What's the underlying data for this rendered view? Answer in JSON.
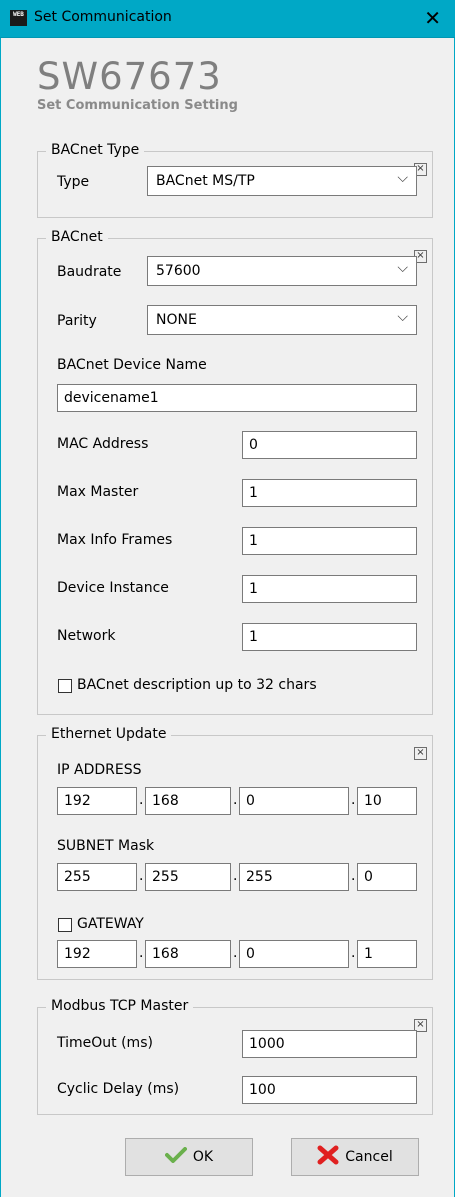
{
  "window": {
    "title": "Set Communication",
    "close_icon": "close-icon",
    "app_icon_text": "WEB"
  },
  "header": {
    "brand": "SW67673",
    "subtitle": "Set Communication Setting"
  },
  "bacnet_type": {
    "legend": "BACnet Type",
    "type_label": "Type",
    "type_value": "BACnet MS/TP"
  },
  "bacnet": {
    "legend": "BACnet",
    "baudrate_label": "Baudrate",
    "baudrate_value": "57600",
    "parity_label": "Parity",
    "parity_value": "NONE",
    "device_name_label": "BACnet Device Name",
    "device_name_value": "devicename1",
    "mac_label": "MAC Address",
    "mac_value": "0",
    "max_master_label": "Max Master",
    "max_master_value": "1",
    "max_info_label": "Max Info Frames",
    "max_info_value": "1",
    "device_instance_label": "Device Instance",
    "device_instance_value": "1",
    "network_label": "Network",
    "network_value": "1",
    "description_checkbox_label": "BACnet description up to 32 chars",
    "description_checked": false
  },
  "ethernet": {
    "legend": "Ethernet Update",
    "ip_label": "IP ADDRESS",
    "ip": [
      "192",
      "168",
      "0",
      "10"
    ],
    "subnet_label": "SUBNET Mask",
    "subnet": [
      "255",
      "255",
      "255",
      "0"
    ],
    "gateway_label": "GATEWAY",
    "gateway_checked": false,
    "gateway": [
      "192",
      "168",
      "0",
      "1"
    ]
  },
  "modbus": {
    "legend": "Modbus TCP Master",
    "timeout_label": "TimeOut (ms)",
    "timeout_value": "1000",
    "cyclic_label": "Cyclic Delay (ms)",
    "cyclic_value": "100"
  },
  "buttons": {
    "ok_label": "OK",
    "cancel_label": "Cancel"
  },
  "colors": {
    "titlebar": "#00a8c6",
    "ok_check": "#6ab04c",
    "cancel_x": "#e02020"
  }
}
